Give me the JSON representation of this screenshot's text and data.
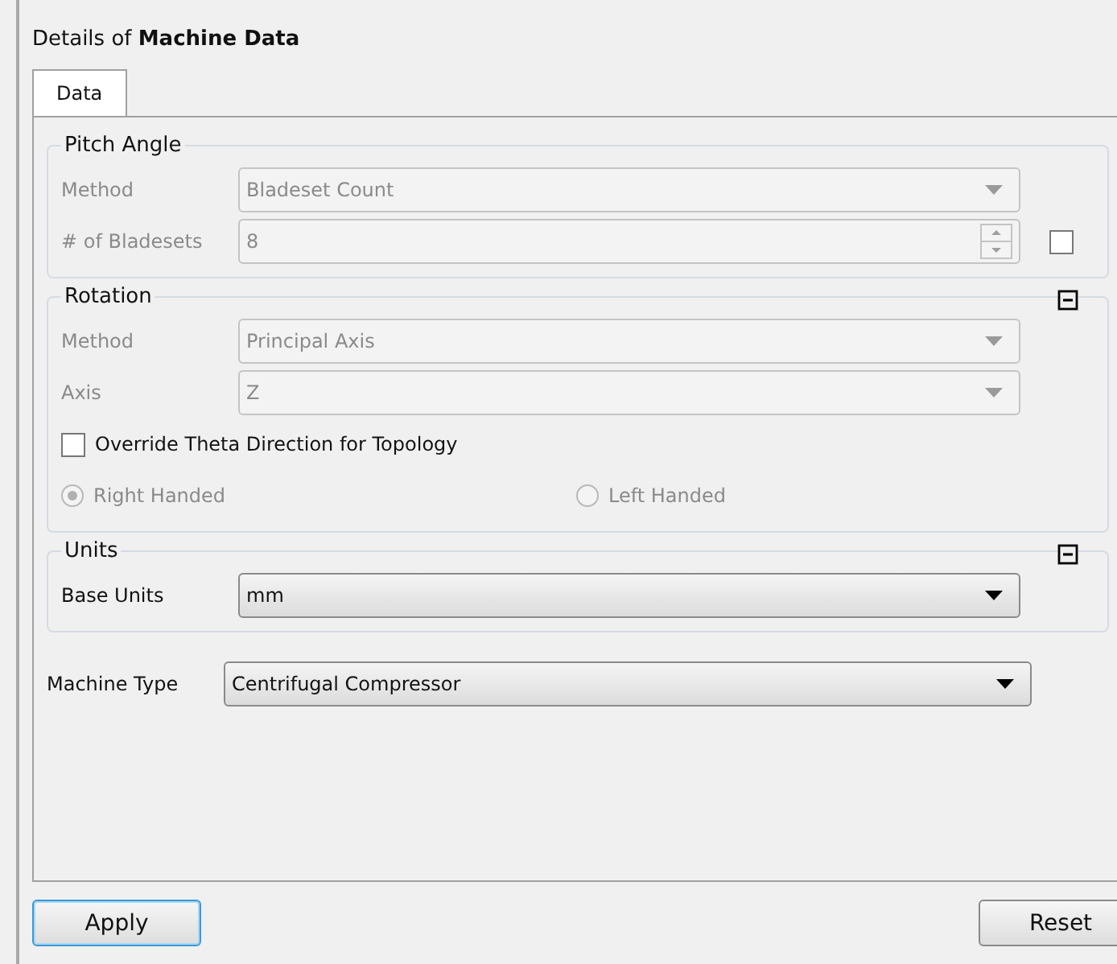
{
  "title": "Details of **Machine Data**",
  "tabs": [
    {
      "label": "Data",
      "selected": true
    }
  ],
  "groups": [
    {
      "title": "Pitch Angle",
      "collapsible": false,
      "rows": [
        {
          "kind": "select",
          "label": "Method",
          "value": "Bladeset Count",
          "disabled": true
        },
        {
          "kind": "spin",
          "label": "# of Bladesets",
          "value": "8",
          "disabled": true,
          "checked": false
        }
      ]
    },
    {
      "title": "Rotation",
      "collapsible": true,
      "rows": [
        {
          "kind": "select",
          "label": "Method",
          "value": "Principal Axis",
          "disabled": true
        },
        {
          "kind": "select",
          "label": "Axis",
          "value": "Z",
          "disabled": true
        },
        {
          "kind": "checkbox",
          "label": "Override Theta Direction for Topology",
          "checked": false,
          "disabled": false
        },
        {
          "kind": "radios",
          "disabled": true,
          "options": [
            {
              "label": "Right Handed",
              "selected": true
            },
            {
              "label": "Left Handed",
              "selected": false
            }
          ]
        }
      ]
    },
    {
      "title": "Units",
      "collapsible": true,
      "rows": [
        {
          "kind": "select",
          "label": "Base Units",
          "value": "mm",
          "disabled": false
        }
      ]
    }
  ],
  "machine_type": {
    "label": "Machine Type",
    "value": "Centrifugal Compressor",
    "disabled": false
  },
  "buttons": [
    {
      "label": "Apply",
      "default": true
    },
    {
      "label": "Reset",
      "default": false
    }
  ]
}
